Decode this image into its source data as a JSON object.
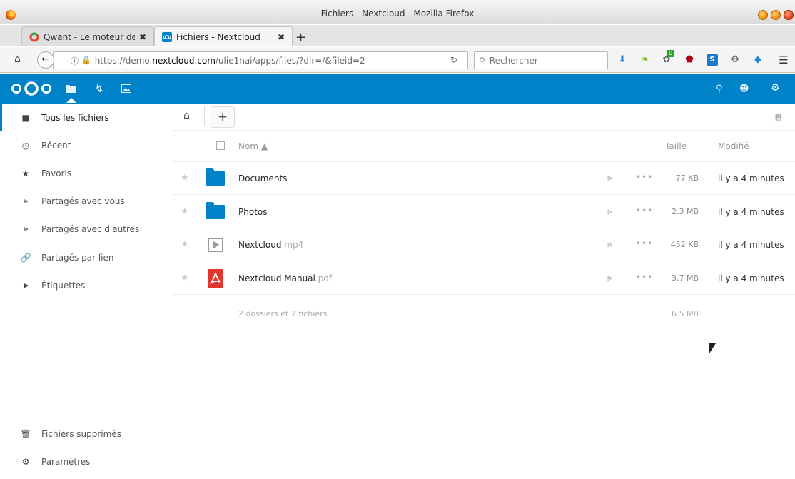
{
  "window": {
    "title": "Fichiers - Nextcloud - Mozilla Firefox"
  },
  "tabs": [
    {
      "label": "Qwant - Le moteur de re",
      "close": "✖"
    },
    {
      "label": "Fichiers - Nextcloud",
      "close": "✖"
    }
  ],
  "newtab": "+",
  "navbar": {
    "url_pre": "https://demo.",
    "url_host": "nextcloud.com",
    "url_post": "/ulie1nai/apps/files/?dir=/&fileid=2",
    "search_placeholder": "Rechercher",
    "badge": "0"
  },
  "sidebar": {
    "items": [
      {
        "label": "Tous les fichiers"
      },
      {
        "label": "Récent"
      },
      {
        "label": "Favoris"
      },
      {
        "label": "Partagés avec vous"
      },
      {
        "label": "Partagés avec d'autres"
      },
      {
        "label": "Partagés par lien"
      },
      {
        "label": "Étiquettes"
      }
    ],
    "bottom": [
      {
        "label": "Fichiers supprimés"
      },
      {
        "label": "Paramètres"
      }
    ]
  },
  "controls": {
    "add": "+"
  },
  "table": {
    "headers": {
      "name": "Nom ▲",
      "size": "Taille",
      "modified": "Modifié"
    },
    "rows": [
      {
        "name": "Documents",
        "ext": "",
        "size": "77 KB",
        "modified": "il y a 4 minutes",
        "type": "folder"
      },
      {
        "name": "Photos",
        "ext": "",
        "size": "2.3 MB",
        "modified": "il y a 4 minutes",
        "type": "folder"
      },
      {
        "name": "Nextcloud",
        "ext": ".mp4",
        "size": "452 KB",
        "modified": "il y a 4 minutes",
        "type": "video"
      },
      {
        "name": "Nextcloud Manual",
        "ext": ".pdf",
        "size": "3.7 MB",
        "modified": "il y a 4 minutes",
        "type": "pdf"
      }
    ],
    "summary": {
      "text": "2 dossiers et 2 fichiers",
      "size": "6.5 MB"
    }
  },
  "colors": {
    "brand": "#0082c9",
    "pdf": "#e3342f"
  }
}
